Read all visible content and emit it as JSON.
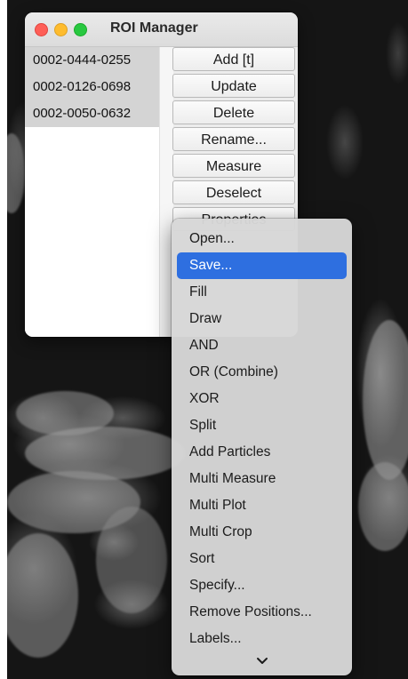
{
  "window": {
    "title": "ROI Manager"
  },
  "roi_list": {
    "items": [
      "0002-0444-0255",
      "0002-0126-0698",
      "0002-0050-0632"
    ]
  },
  "buttons": {
    "add": "Add [t]",
    "update": "Update",
    "delete": "Delete",
    "rename": "Rename...",
    "measure": "Measure",
    "deselect": "Deselect",
    "properties": "Properties"
  },
  "menu": {
    "items": [
      "Open...",
      "Save...",
      "Fill",
      "Draw",
      "AND",
      "OR (Combine)",
      "XOR",
      "Split",
      "Add Particles",
      "Multi Measure",
      "Multi Plot",
      "Multi Crop",
      "Sort",
      "Specify...",
      "Remove Positions...",
      "Labels..."
    ],
    "selected_item": "Save...",
    "more_indicator_icon": "chevron-down-icon"
  },
  "colors": {
    "selection": "#2e6fe0",
    "close": "#fe5f57",
    "minimize": "#febc2e",
    "maximize": "#28c840"
  }
}
